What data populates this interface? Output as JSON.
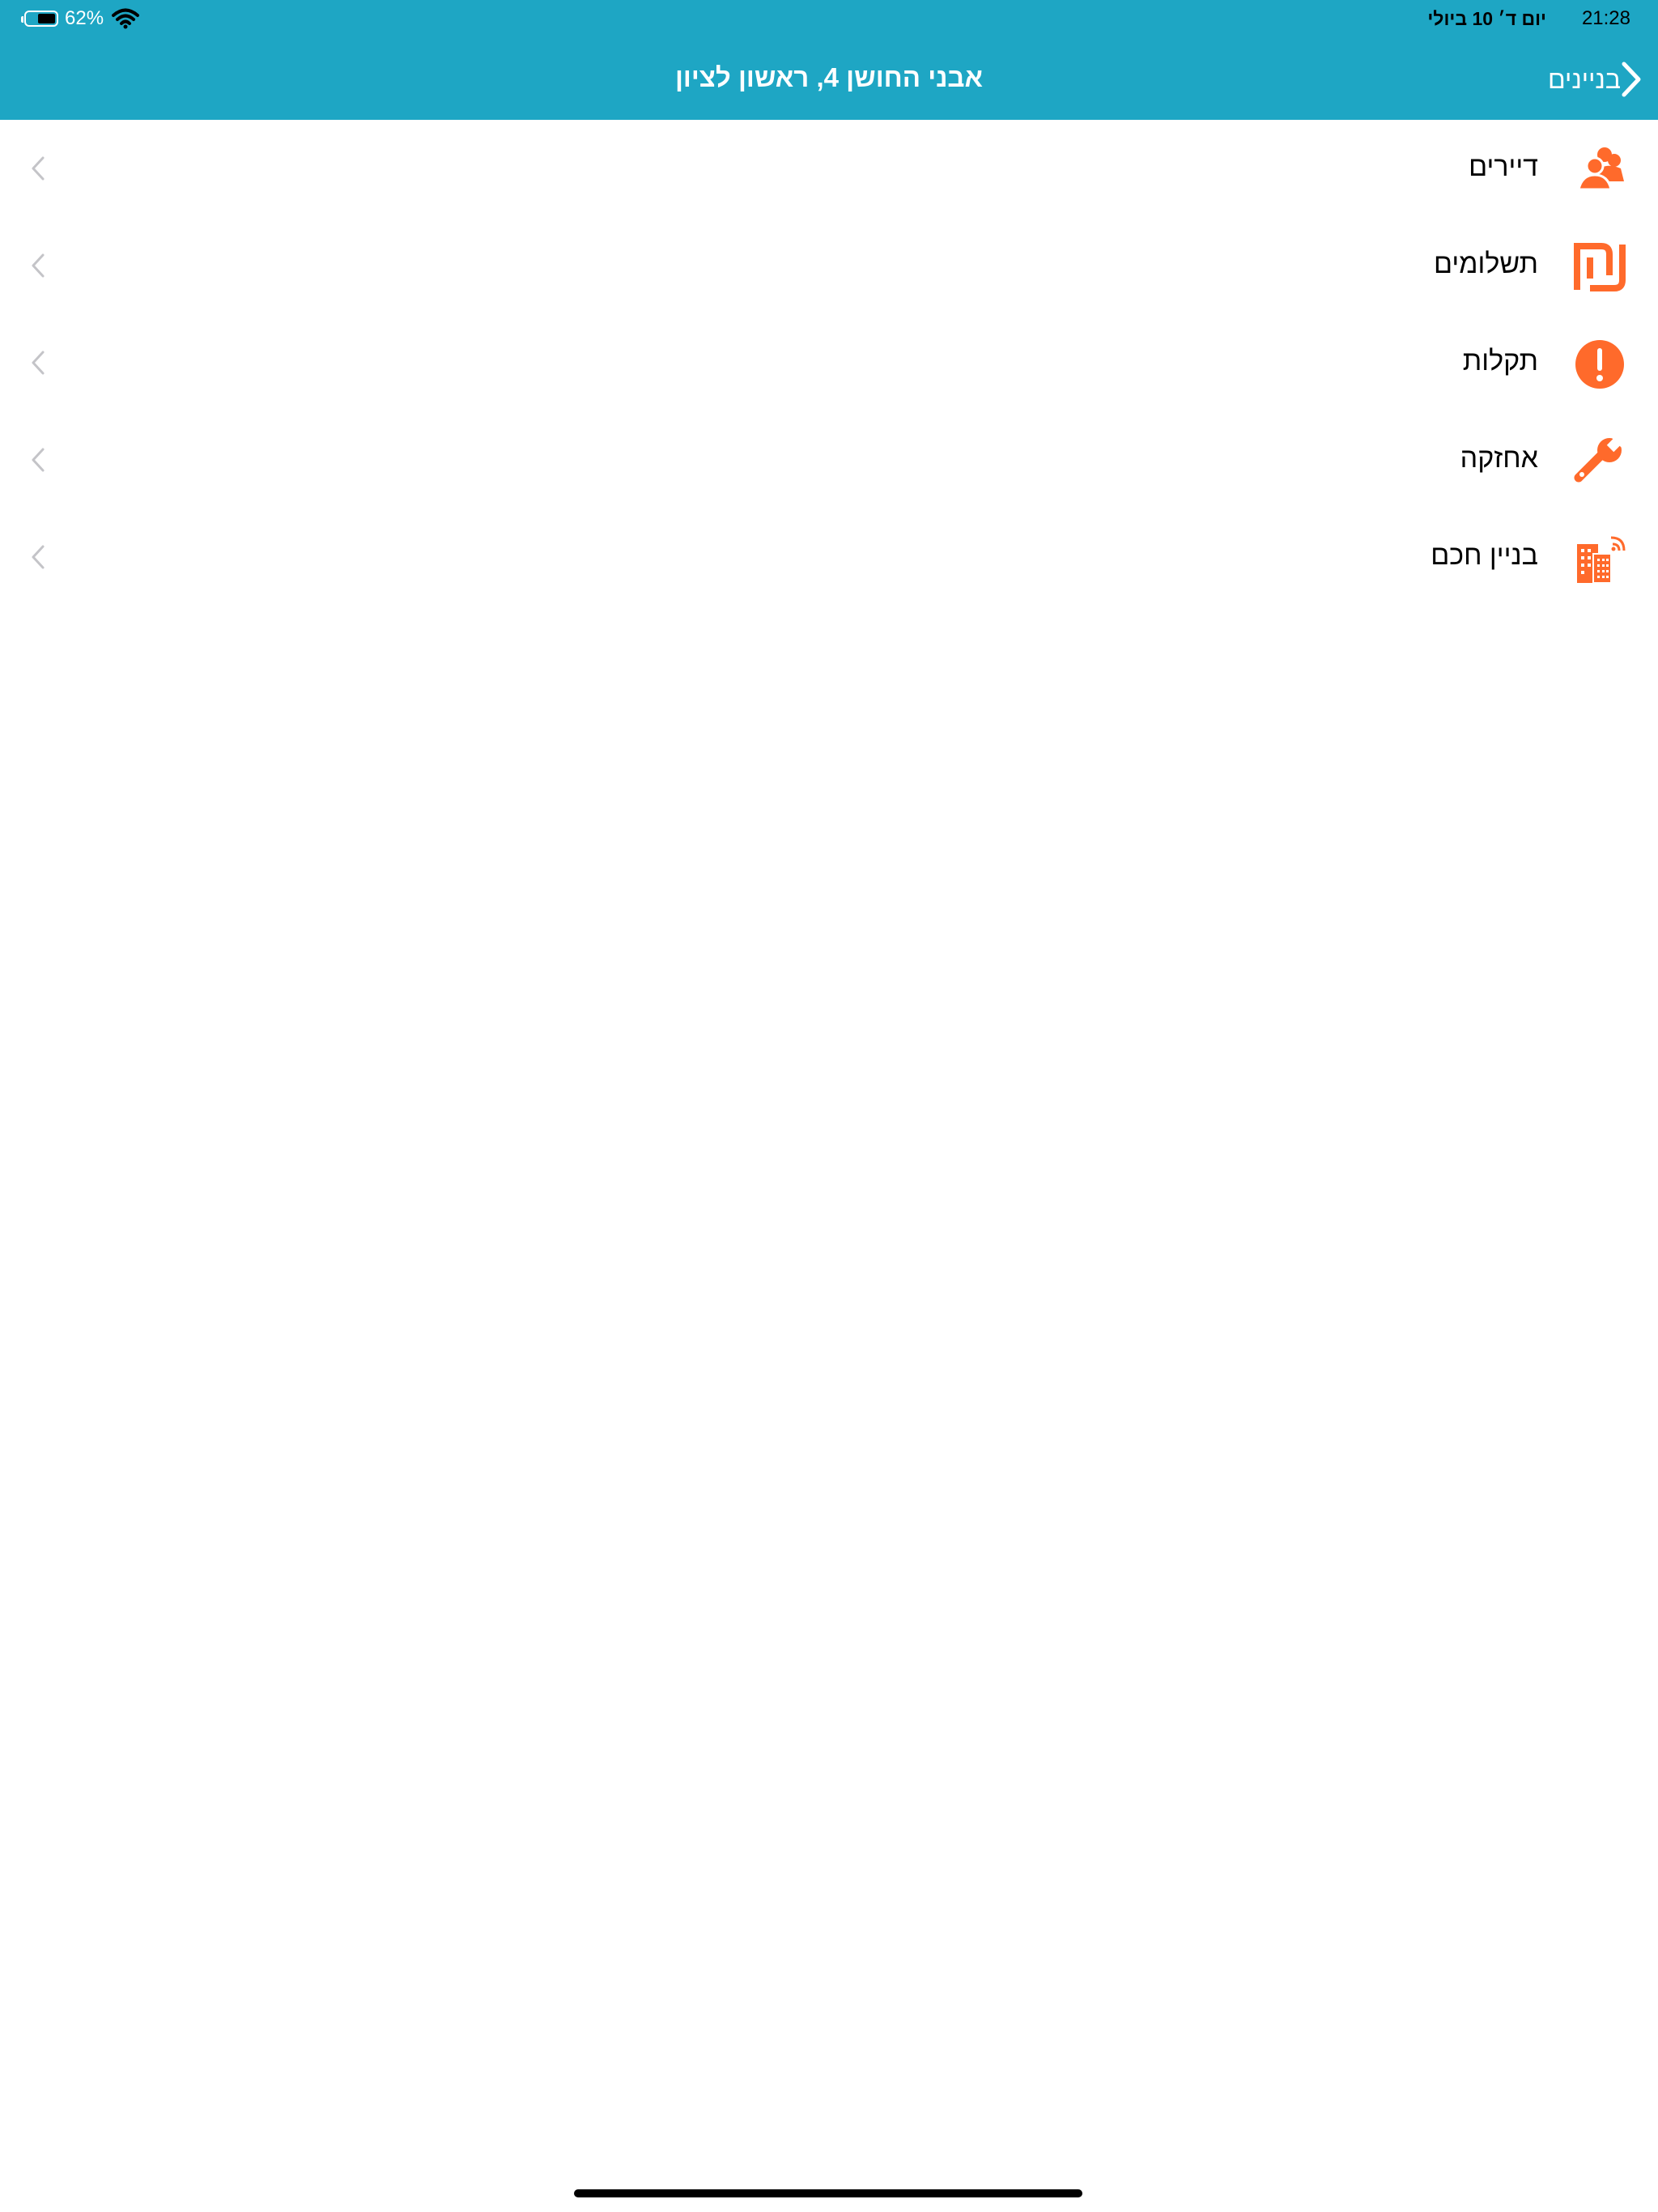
{
  "status_bar": {
    "time": "21:28",
    "date": "יום ד׳ 10 ביולי",
    "battery_percent_label": "62%",
    "battery_level": 0.62
  },
  "nav": {
    "title": "אבני החושן 4, ראשון לציון",
    "back_label": "בניינים"
  },
  "menu": {
    "items": [
      {
        "label": "דיירים",
        "icon": "residents-icon"
      },
      {
        "label": "תשלומים",
        "icon": "shekel-icon"
      },
      {
        "label": "תקלות",
        "icon": "alert-icon"
      },
      {
        "label": "אחזקה",
        "icon": "wrench-icon"
      },
      {
        "label": "בניין חכם",
        "icon": "smart-building-icon"
      }
    ]
  },
  "colors": {
    "header": "#1ea6c4",
    "accent_orange": "#ff6a2b",
    "chevron_gray": "#c4c4c8"
  }
}
